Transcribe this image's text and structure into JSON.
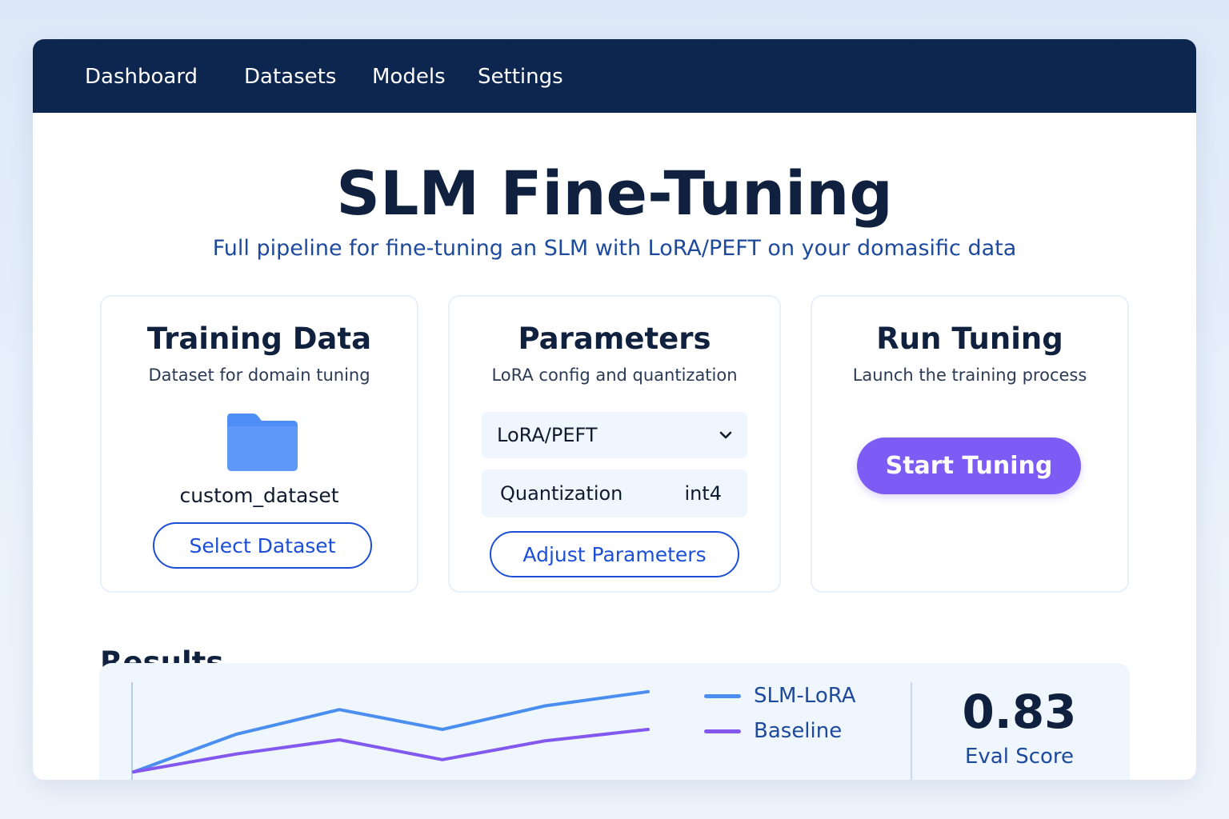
{
  "nav": {
    "items": [
      {
        "label": "Dashboard"
      },
      {
        "label": "Datasets"
      },
      {
        "label": "Models"
      },
      {
        "label": "Settings"
      }
    ]
  },
  "header": {
    "title": "SLM Fine-Tuning",
    "subtitle": "Full pipeline for fine-tuning an SLM with LoRA/PEFT on your domasific data"
  },
  "cards": {
    "training_data": {
      "title": "Training Data",
      "subtitle": "Dataset for domain tuning",
      "icon": "folder-icon",
      "dataset_name": "custom_dataset",
      "button_label": "Select Dataset"
    },
    "parameters": {
      "title": "Parameters",
      "subtitle": "LoRA config and quantization",
      "method_select": {
        "value": "LoRA/PEFT"
      },
      "quantization": {
        "label": "Quantization",
        "value": "int4"
      },
      "button_label": "Adjust Parameters"
    },
    "run_tuning": {
      "title": "Run Tuning",
      "subtitle": "Launch the training process",
      "button_label": "Start Tuning"
    }
  },
  "results": {
    "heading": "Results",
    "eval_score": {
      "value": "0.83",
      "label": "Eval Score"
    }
  },
  "colors": {
    "navbar": "#0d2650",
    "accent_blue": "#1c4fd6",
    "series_slm_lora": "#4a8ef0",
    "series_baseline": "#8358ee",
    "start_button": "#7c5cf5"
  },
  "chart_data": {
    "type": "line",
    "title": "",
    "xlabel": "",
    "ylabel": "",
    "x": [
      1,
      2,
      3,
      4,
      5,
      6
    ],
    "ylim": [
      0,
      1
    ],
    "grid": false,
    "legend_position": "right",
    "series": [
      {
        "name": "SLM-LoRA",
        "color": "#4a8ef0",
        "values": [
          0.05,
          0.45,
          0.71,
          0.5,
          0.75,
          0.9
        ]
      },
      {
        "name": "Baseline",
        "color": "#8358ee",
        "values": [
          0.05,
          0.24,
          0.39,
          0.18,
          0.38,
          0.5
        ]
      }
    ]
  }
}
